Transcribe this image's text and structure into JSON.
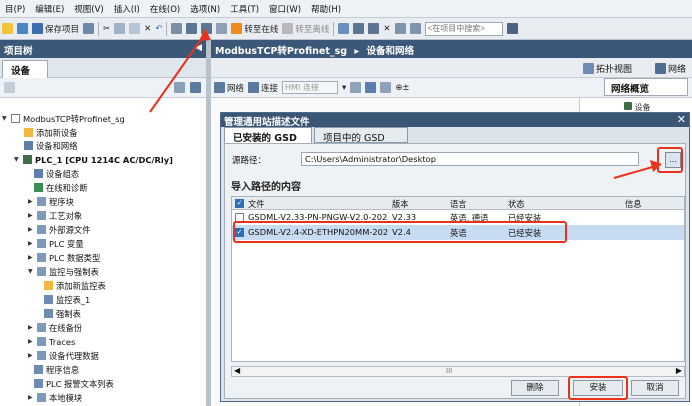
{
  "colors": {
    "accent": "#3c5878",
    "highlight": "#e8321e",
    "selected_row": "#c7dcf2"
  },
  "menu": [
    "目(P)",
    "编辑(E)",
    "视图(V)",
    "插入(I)",
    "在线(O)",
    "选项(N)",
    "工具(T)",
    "窗口(W)",
    "帮助(H)"
  ],
  "toolbar": {
    "save_project": "保存项目",
    "go_online": "转至在线",
    "go_offline": "转至离线",
    "search_placeholder": "<在项目中搜索>"
  },
  "left_panel": {
    "title": "项目树",
    "tab": "设备",
    "tree": [
      "ModbusTCP转Profinet_sg",
      "添加新设备",
      "设备和网络",
      "PLC_1 [CPU 1214C AC/DC/Rly]",
      "设备组态",
      "在线和诊断",
      "程序块",
      "工艺对象",
      "外部源文件",
      "PLC 变量",
      "PLC 数据类型",
      "监控与强制表",
      "添加新监控表",
      "监控表_1",
      "强制表",
      "在线备份",
      "Traces",
      "设备代理数据",
      "程序信息",
      "PLC 报警文本列表",
      "本地模块"
    ]
  },
  "right_panel": {
    "breadcrumb_project": "ModbusTCP转Profinet_sg",
    "breadcrumb_sep": "▸",
    "breadcrumb_page": "设备和网络",
    "topology_view": "拓扑视图",
    "network_view": "网络",
    "network_overview_tab": "网络概览",
    "network_btn": "网络",
    "connection_btn": "连接",
    "hmi_connection": "HMI 连接",
    "side_item": "设备"
  },
  "dialog": {
    "title": "管理通用站描述文件",
    "tab_installed": "已安装的 GSD",
    "tab_project": "项目中的 GSD",
    "source_path_label": "源路径：",
    "source_path_value": "C:\\Users\\Administrator\\Desktop",
    "browse_label": "...",
    "section_title": "导入路径的内容",
    "columns": {
      "file": "文件",
      "version": "版本",
      "language": "语言",
      "status": "状态",
      "info": "信息"
    },
    "rows": [
      {
        "file": "GSDML-V2.33-PN-PNGW-V2.0-202...",
        "version": "V2.33",
        "language": "英语, 德语",
        "status": "已经安装",
        "checked": false
      },
      {
        "file": "GSDML-V2.4-XD-ETHPN20MM-202...",
        "version": "V2.4",
        "language": "英语",
        "status": "已经安装",
        "checked": true
      }
    ],
    "scroll_mid": "III",
    "delete_btn": "删除",
    "install_btn": "安装",
    "cancel_btn": "取消"
  }
}
